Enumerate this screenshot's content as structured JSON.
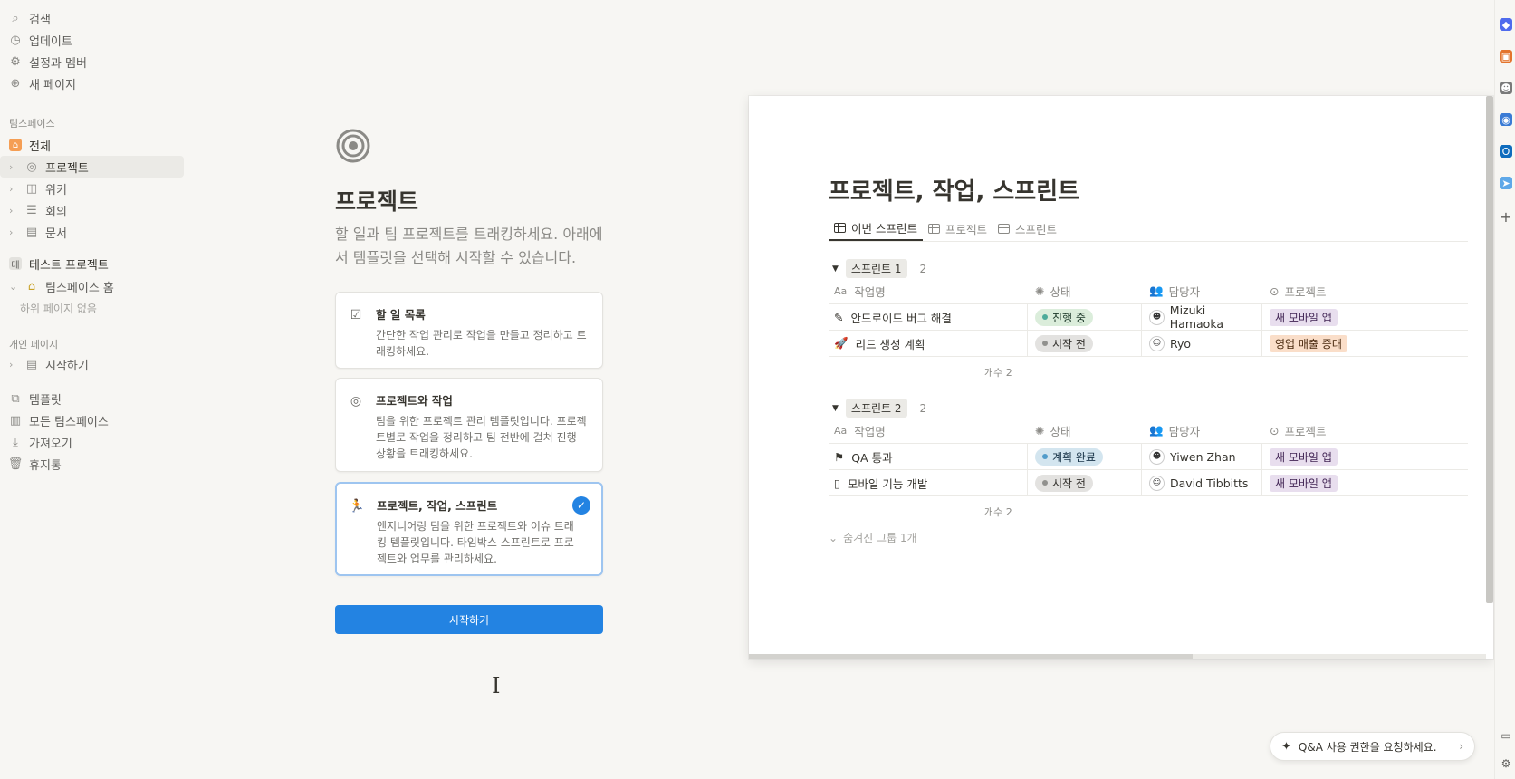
{
  "sidebar": {
    "top_items": [
      {
        "label": "검색",
        "icon": "search-icon"
      },
      {
        "label": "업데이트",
        "icon": "clock-icon"
      },
      {
        "label": "설정과 멤버",
        "icon": "gear-icon"
      },
      {
        "label": "새 페이지",
        "icon": "plus-circle-icon"
      }
    ],
    "teamspace_header": "팀스페이스",
    "teamspace_items": [
      {
        "label": "전체",
        "icon": "home-icon"
      },
      {
        "label": "프로젝트",
        "icon": "target-icon"
      },
      {
        "label": "위키",
        "icon": "book-icon"
      },
      {
        "label": "회의",
        "icon": "list-icon"
      },
      {
        "label": "문서",
        "icon": "doc-icon"
      }
    ],
    "test_project": {
      "badge": "테",
      "label": "테스트 프로젝트"
    },
    "teamspace_home": "팀스페이스 홈",
    "no_subpages": "하위 페이지 없음",
    "private_header": "개인 페이지",
    "private_items": [
      {
        "label": "시작하기"
      }
    ],
    "bottom_items": [
      {
        "label": "템플릿",
        "icon": "shapes-icon"
      },
      {
        "label": "모든 팀스페이스",
        "icon": "building-icon"
      },
      {
        "label": "가져오기",
        "icon": "download-icon"
      },
      {
        "label": "휴지통",
        "icon": "trash-icon"
      }
    ]
  },
  "chooser": {
    "title": "프로젝트",
    "description": "할 일과 팀 프로젝트를 트래킹하세요. 아래에서 템플릿을 선택해 시작할 수 있습니다.",
    "cards": [
      {
        "title": "할 일 목록",
        "desc": "간단한 작업 관리로 작업을 만들고 정리하고 트래킹하세요.",
        "icon": "checkbox-icon",
        "selected": false
      },
      {
        "title": "프로젝트와 작업",
        "desc": "팀을 위한 프로젝트 관리 템플릿입니다. 프로젝트별로 작업을 정리하고 팀 전반에 걸쳐 진행 상황을 트래킹하세요.",
        "icon": "target-icon",
        "selected": false
      },
      {
        "title": "프로젝트, 작업, 스프린트",
        "desc": "엔지니어링 팀을 위한 프로젝트와 이슈 트래킹 템플릿입니다. 타임박스 스프린트로 프로젝트와 업무를 관리하세요.",
        "icon": "runner-icon",
        "selected": true
      }
    ],
    "start_button": "시작하기"
  },
  "preview": {
    "title": "프로젝트, 작업, 스프린트",
    "tabs": [
      "이번 스프린트",
      "프로젝트",
      "스프린트"
    ],
    "columns": {
      "name": "작업명",
      "status": "상태",
      "assignee": "담당자",
      "project": "프로젝트",
      "name_prefix": "Aa"
    },
    "groups": [
      {
        "name": "스프린트 1",
        "count": "2",
        "footer": "개수 2",
        "rows": [
          {
            "emoji": "✎",
            "task": "안드로이드 버그 해결",
            "status": "진행 중",
            "status_color": "#4dab9a",
            "status_bg": "#dbeddb",
            "assignee": "Mizuki Hamaoka",
            "avatar": "☻",
            "project": "새 모바일 앱",
            "project_color": "purple"
          },
          {
            "emoji": "🚀",
            "task": "리드 생성 계획",
            "status": "시작 전",
            "status_color": "#91918e",
            "status_bg": "#e3e2e0",
            "assignee": "Ryo",
            "avatar": "☺",
            "project": "영업 매출 증대",
            "project_color": "orange"
          }
        ]
      },
      {
        "name": "스프린트 2",
        "count": "2",
        "footer": "개수 2",
        "rows": [
          {
            "emoji": "⚑",
            "task": "QA 통과",
            "status": "계획 완료",
            "status_color": "#529cca",
            "status_bg": "#d3e5ef",
            "assignee": "Yiwen Zhan",
            "avatar": "☻",
            "project": "새 모바일 앱",
            "project_color": "purple"
          },
          {
            "emoji": "▯",
            "task": "모바일 기능 개발",
            "status": "시작 전",
            "status_color": "#91918e",
            "status_bg": "#e3e2e0",
            "assignee": "David Tibbitts",
            "avatar": "☺",
            "project": "새 모바일 앱",
            "project_color": "purple"
          }
        ]
      }
    ],
    "hidden_groups": "숨겨진 그룹 1개"
  },
  "qa": {
    "label": "Q&A 사용 권한을 요청하세요."
  }
}
